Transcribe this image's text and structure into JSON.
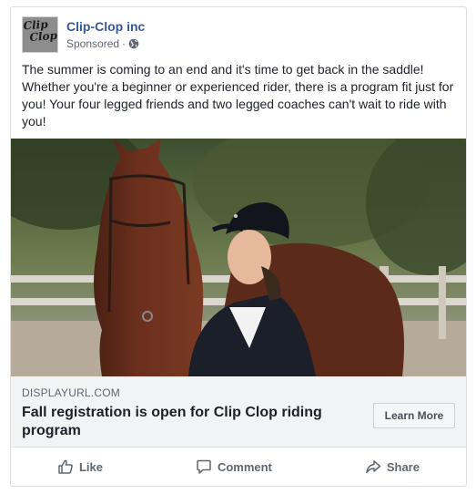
{
  "page": {
    "name": "Clip-Clop inc",
    "sponsored_label": "Sponsored",
    "separator": "·",
    "logo_line1": "Clip",
    "logo_line2": "Clop."
  },
  "post": {
    "text": "The summer is coming to an end and it's time to get back in the saddle! Whether you're a beginner or experienced rider, there is a program fit just for you! Your four legged friends and two legged coaches can't wait to ride with you!"
  },
  "link": {
    "display_url": "DISPLAYURL.COM",
    "headline": "Fall registration is open for Clip Clop riding program",
    "cta_label": "Learn More"
  },
  "actions": {
    "like": "Like",
    "comment": "Comment",
    "share": "Share"
  },
  "icons": {
    "audience": "globe-icon",
    "like": "thumbs-up-icon",
    "comment": "speech-bubble-icon",
    "share": "share-arrow-icon"
  },
  "colors": {
    "page_name": "#365899",
    "meta_text": "#616770",
    "link_box_bg": "#f2f3f5",
    "action_text": "#606770"
  }
}
